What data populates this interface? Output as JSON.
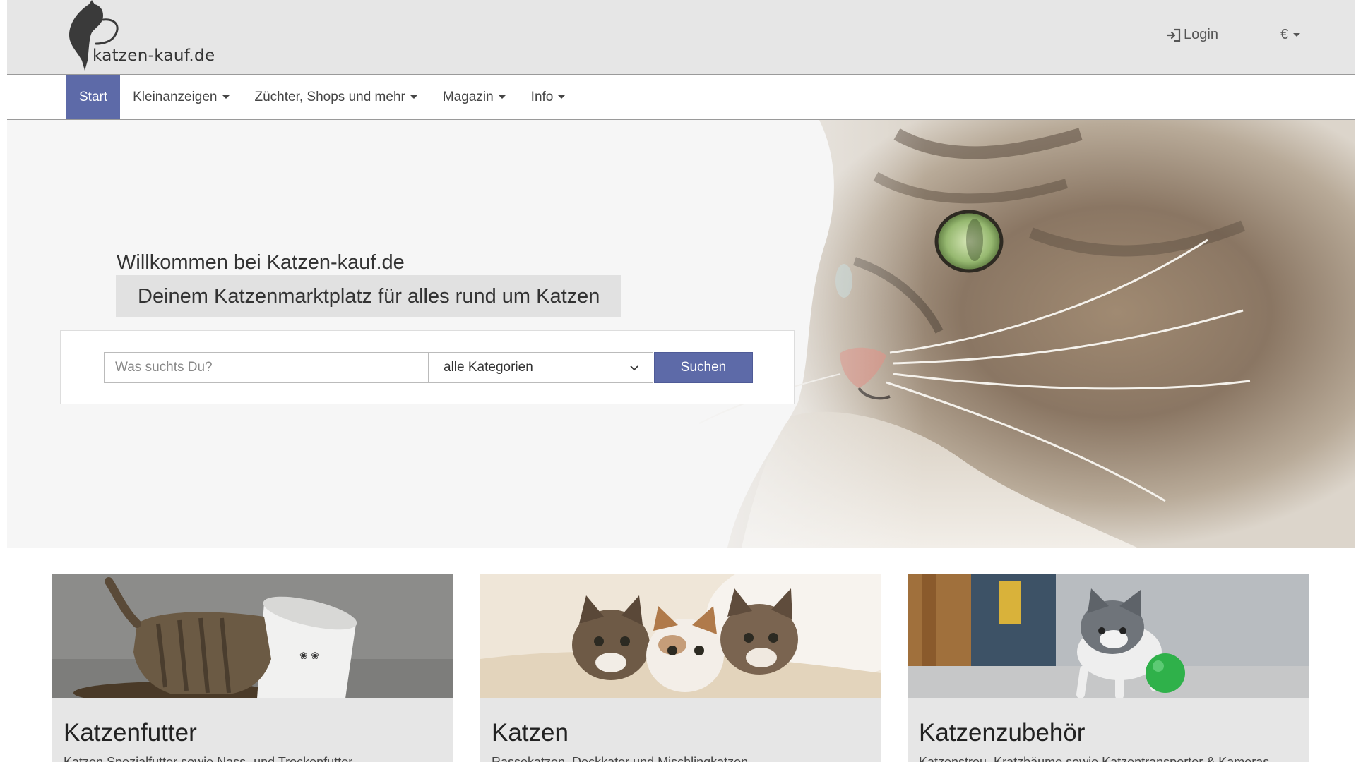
{
  "header": {
    "logo_text": "katzen-kauf.de",
    "login_label": "Login",
    "currency_label": "€"
  },
  "nav": {
    "items": [
      {
        "label": "Start",
        "active": true,
        "dropdown": false
      },
      {
        "label": "Kleinanzeigen",
        "active": false,
        "dropdown": true
      },
      {
        "label": "Züchter, Shops und mehr",
        "active": false,
        "dropdown": true
      },
      {
        "label": "Magazin",
        "active": false,
        "dropdown": true
      },
      {
        "label": "Info",
        "active": false,
        "dropdown": true
      }
    ]
  },
  "hero": {
    "title": "Willkommen bei Katzen-kauf.de",
    "subtitle": "Deinem Katzenmarktplatz für alles rund um Katzen"
  },
  "search": {
    "placeholder": "Was suchts Du?",
    "category_selected": "alle Kategorien",
    "button_label": "Suchen"
  },
  "cards": [
    {
      "title": "Katzenfutter",
      "description": "Katzen Spezialfutter sowie Nass- und Trockenfutter"
    },
    {
      "title": "Katzen",
      "description": "Rassekatzen, Deckkater und Mischlingkatzen"
    },
    {
      "title": "Katzenzubehör",
      "description": "Katzenstreu, Kratzbäume sowie Katzentransporter & Kameras"
    }
  ],
  "colors": {
    "accent": "#5d6aa8",
    "header_bg": "#e6e6e6",
    "card_bg": "#e6e6e6"
  }
}
